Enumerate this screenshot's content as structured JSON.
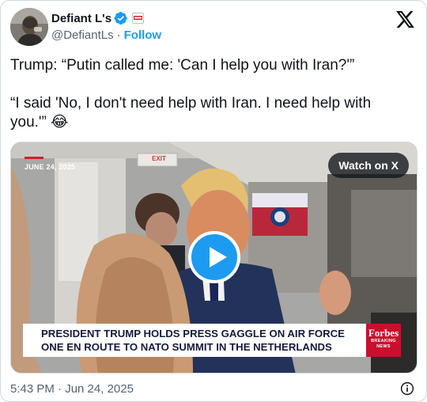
{
  "author": {
    "display_name": "Defiant L's",
    "handle": "@DefiantLs",
    "separator": "·",
    "follow_label": "Follow",
    "verified_color": "#1d9bf0",
    "avatar_icon": "person-avatar",
    "affiliate_badge_icon": "rtm-badge-icon"
  },
  "tweet": {
    "paragraphs": [
      "Trump: “Putin called me: 'Can I help you with Iran?'”",
      "“I said 'No, I don't need help with Iran. I need help with you.'” 😂"
    ],
    "timestamp": "5:43 PM · Jun 24, 2025"
  },
  "media": {
    "date_stamp": "JUNE 24, 2025",
    "watch_label": "Watch on X",
    "chyron_lines": [
      "PRESIDENT TRUMP HOLDS PRESS GAGGLE ON AIR FORCE",
      "ONE EN ROUTE TO NATO SUMMIT IN THE NETHERLANDS"
    ],
    "sign_text": "EXIT",
    "network_logo": {
      "name": "Forbes",
      "sub_lines": [
        "BREAKING",
        "NEWS"
      ],
      "color": "#c8102e"
    }
  },
  "colors": {
    "accent": "#1d9bf0",
    "text_primary": "#0f1419",
    "text_secondary": "#536471",
    "border": "#cfd9de"
  }
}
